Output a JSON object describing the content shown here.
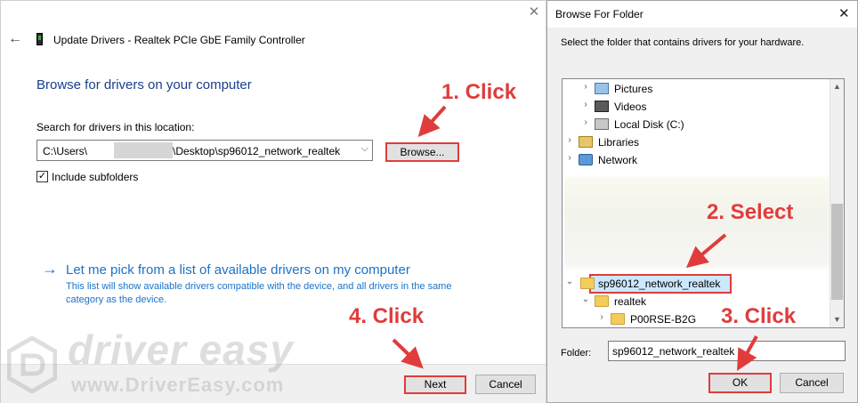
{
  "wizard": {
    "title": "Update Drivers - Realtek PCIe GbE Family Controller",
    "heading": "Browse for drivers on your computer",
    "search_label": "Search for drivers in this location:",
    "path_prefix": "C:\\Users\\",
    "path_suffix": "\\Desktop\\sp96012_network_realtek",
    "browse_label": "Browse...",
    "include_subfolders_label": "Include subfolders",
    "include_subfolders_checked": true,
    "pick_link": "Let me pick from a list of available drivers on my computer",
    "pick_description": "This list will show available drivers compatible with the device, and all drivers in the same category as the device.",
    "next_label": "Next",
    "cancel_label": "Cancel"
  },
  "browse_dialog": {
    "title": "Browse For Folder",
    "instruction": "Select the folder that contains drivers for your hardware.",
    "tree": [
      {
        "label": "Pictures",
        "icon": "pictures-icon",
        "expander": "›"
      },
      {
        "label": "Videos",
        "icon": "videos-icon",
        "expander": "›"
      },
      {
        "label": "Local Disk (C:)",
        "icon": "disk-icon",
        "expander": "›"
      },
      {
        "label": "Libraries",
        "icon": "libraries-icon",
        "expander": "›"
      },
      {
        "label": "Network",
        "icon": "network-icon",
        "expander": "›"
      },
      {
        "label": "sp96012_network_realtek",
        "icon": "folder-icon",
        "expander": "⌄",
        "selected": true
      },
      {
        "label": "realtek",
        "icon": "folder-icon",
        "expander": "⌄"
      },
      {
        "label": "P00RSE-B2G",
        "icon": "folder-icon",
        "expander": "›"
      }
    ],
    "folder_label": "Folder:",
    "folder_value": "sp96012_network_realtek",
    "ok_label": "OK",
    "cancel_label": "Cancel"
  },
  "annotations": {
    "step1": "1. Click",
    "step2": "2. Select",
    "step3": "3. Click",
    "step4": "4. Click",
    "color": "#e03c3c"
  },
  "watermark": {
    "brand": "driver easy",
    "url": "www.DriverEasy.com"
  }
}
